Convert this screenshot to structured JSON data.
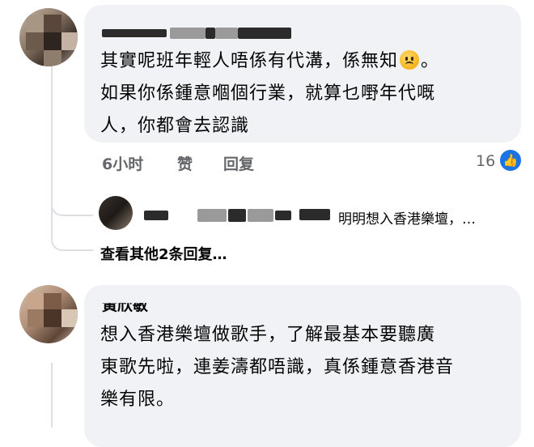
{
  "comments": [
    {
      "name": "",
      "text_lines": [
        "其實呢班年輕人唔係有代溝，係無知",
        "如果你係鍾意嗰個行業，就算乜嘢年代嘅",
        "人，你都會去認識"
      ],
      "line1_suffix": "。",
      "emoji": "sad-face-emoji",
      "actions": {
        "time": "6小时",
        "like": "赞",
        "reply": "回复"
      },
      "like_count": "16",
      "reply_preview": {
        "text": "明明想入香港樂壇，…"
      },
      "more_replies": "查看其他2条回复…"
    },
    {
      "name": "黃欣敏",
      "text_lines": [
        "想入香港樂壇做歌手，了解最基本要聽廣",
        "東歌先啦，連姜濤都唔識，真係鍾意香港音",
        "樂有限。"
      ]
    }
  ],
  "colors": {
    "bubble": "#f0f2f5",
    "like_blue": "#1b74e4",
    "muted": "#65676b",
    "thread": "#dcdfe4"
  }
}
